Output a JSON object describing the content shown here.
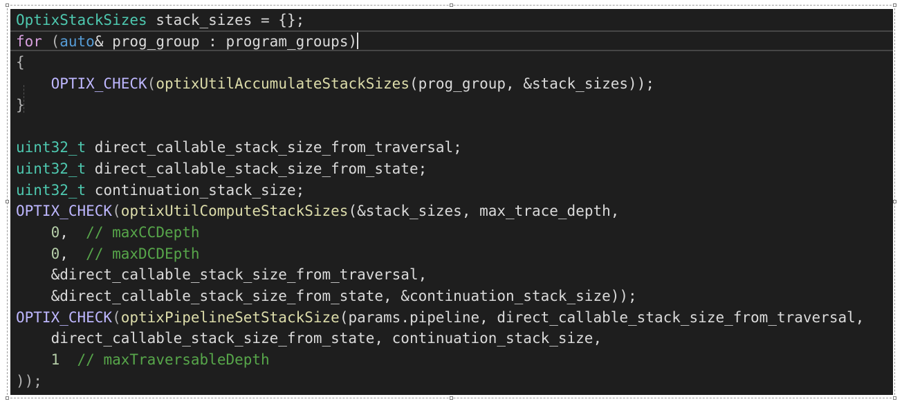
{
  "editor": {
    "lines": [
      [
        {
          "t": "OptixStackSizes",
          "c": "ty"
        },
        {
          "t": " stack_sizes = {};",
          "c": "id"
        }
      ],
      [
        {
          "t": "for",
          "c": "kw"
        },
        {
          "t": " (",
          "c": "pu"
        },
        {
          "t": "auto",
          "c": "kw2"
        },
        {
          "t": "& prog_group : program_groups)",
          "c": "id"
        }
      ],
      [
        {
          "t": "{",
          "c": "pu"
        }
      ],
      [
        {
          "t": "    ",
          "c": "id"
        },
        {
          "t": "OPTIX_CHECK",
          "c": "mac"
        },
        {
          "t": "(",
          "c": "pu"
        },
        {
          "t": "optixUtilAccumulateStackSizes",
          "c": "fn"
        },
        {
          "t": "(prog_group, &stack_sizes));",
          "c": "id"
        }
      ],
      [
        {
          "t": "}",
          "c": "pu"
        }
      ],
      [],
      [
        {
          "t": "uint32_t",
          "c": "ty"
        },
        {
          "t": " direct_callable_stack_size_from_traversal;",
          "c": "id"
        }
      ],
      [
        {
          "t": "uint32_t",
          "c": "ty"
        },
        {
          "t": " direct_callable_stack_size_from_state;",
          "c": "id"
        }
      ],
      [
        {
          "t": "uint32_t",
          "c": "ty"
        },
        {
          "t": " continuation_stack_size;",
          "c": "id"
        }
      ],
      [
        {
          "t": "OPTIX_CHECK",
          "c": "mac"
        },
        {
          "t": "(",
          "c": "pu"
        },
        {
          "t": "optixUtilComputeStackSizes",
          "c": "fn"
        },
        {
          "t": "(&stack_sizes, max_trace_depth,",
          "c": "id"
        }
      ],
      [
        {
          "t": "    ",
          "c": "id"
        },
        {
          "t": "0",
          "c": "nm"
        },
        {
          "t": ",  ",
          "c": "id"
        },
        {
          "t": "// maxCCDepth",
          "c": "cm"
        }
      ],
      [
        {
          "t": "    ",
          "c": "id"
        },
        {
          "t": "0",
          "c": "nm"
        },
        {
          "t": ",  ",
          "c": "id"
        },
        {
          "t": "// maxDCDEpth",
          "c": "cm"
        }
      ],
      [
        {
          "t": "    &direct_callable_stack_size_from_traversal,",
          "c": "id"
        }
      ],
      [
        {
          "t": "    &direct_callable_stack_size_from_state, &continuation_stack_size));",
          "c": "id"
        }
      ],
      [
        {
          "t": "OPTIX_CHECK",
          "c": "mac"
        },
        {
          "t": "(",
          "c": "pu"
        },
        {
          "t": "optixPipelineSetStackSize",
          "c": "fn"
        },
        {
          "t": "(params.pipeline, direct_callable_stack_size_from_traversal,",
          "c": "id"
        }
      ],
      [
        {
          "t": "    direct_callable_stack_size_from_state, continuation_stack_size,",
          "c": "id"
        }
      ],
      [
        {
          "t": "    ",
          "c": "id"
        },
        {
          "t": "1",
          "c": "nm"
        },
        {
          "t": "  ",
          "c": "id"
        },
        {
          "t": "// maxTraversableDepth",
          "c": "cm"
        }
      ],
      [
        {
          "t": "));",
          "c": "pu"
        }
      ]
    ],
    "caret_line": 1
  },
  "colors": {
    "background": "#1e1e1e",
    "type": "#4ec9b0",
    "keyword": "#d8a0df",
    "macro": "#beb7ff",
    "function": "#dcdcaa",
    "comment": "#57a64a",
    "number": "#b5cea8",
    "text": "#dadada"
  }
}
